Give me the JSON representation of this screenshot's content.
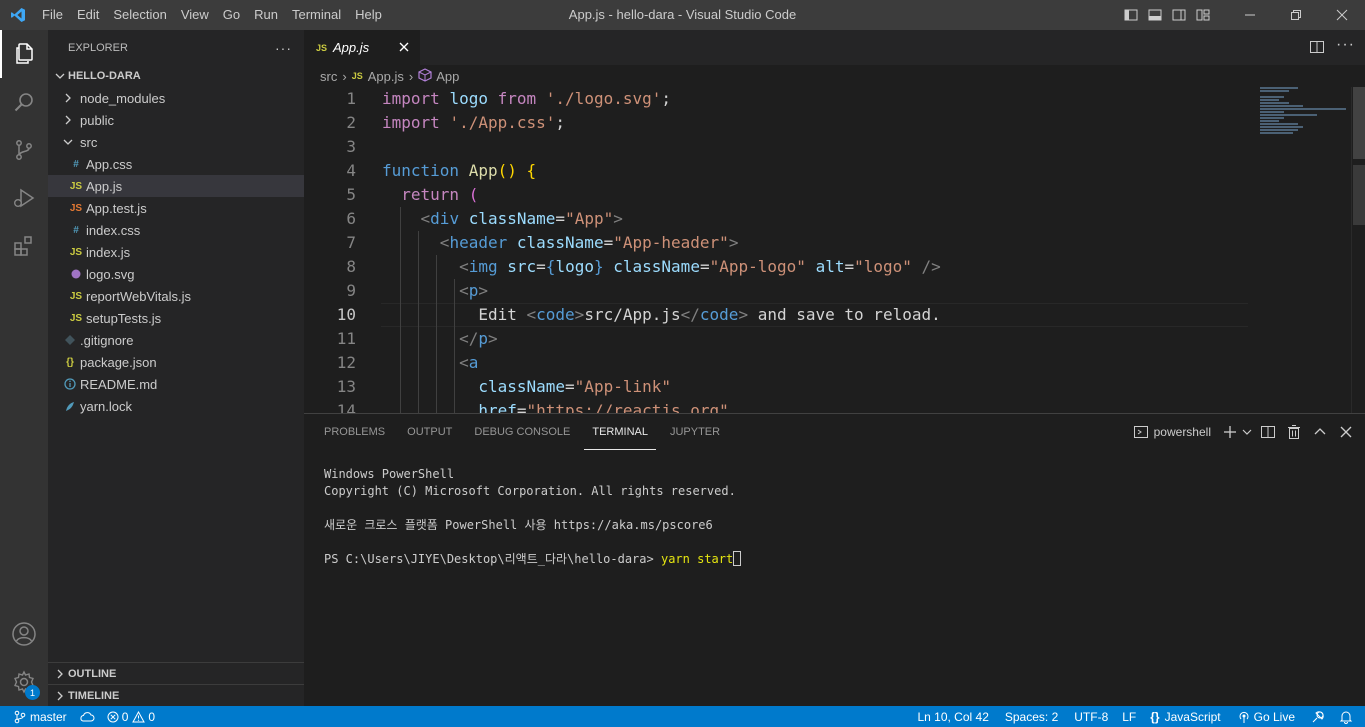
{
  "titlebar": {
    "menu": [
      "File",
      "Edit",
      "Selection",
      "View",
      "Go",
      "Run",
      "Terminal",
      "Help"
    ],
    "window_title": "App.js - hello-dara - Visual Studio Code"
  },
  "activitybar": {
    "items": [
      "files-icon",
      "search-icon",
      "source-control-icon",
      "run-debug-icon",
      "extensions-icon"
    ],
    "bottom": [
      "account-icon",
      "manage-gear-icon"
    ],
    "manage_badge": "1"
  },
  "explorer": {
    "header": "EXPLORER",
    "more": "···",
    "root": "HELLO-DARA",
    "items": [
      {
        "name": "node_modules",
        "kind": "folder",
        "depth": 0
      },
      {
        "name": "public",
        "kind": "folder",
        "depth": 0
      },
      {
        "name": "src",
        "kind": "folder-open",
        "depth": 0
      },
      {
        "name": "App.css",
        "kind": "css",
        "depth": 1
      },
      {
        "name": "App.js",
        "kind": "js",
        "depth": 1
      },
      {
        "name": "App.test.js",
        "kind": "test",
        "depth": 1
      },
      {
        "name": "index.css",
        "kind": "css",
        "depth": 1
      },
      {
        "name": "index.js",
        "kind": "js",
        "depth": 1
      },
      {
        "name": "logo.svg",
        "kind": "svg",
        "depth": 1
      },
      {
        "name": "reportWebVitals.js",
        "kind": "js",
        "depth": 1
      },
      {
        "name": "setupTests.js",
        "kind": "js",
        "depth": 1
      },
      {
        "name": ".gitignore",
        "kind": "git",
        "depth": 0
      },
      {
        "name": "package.json",
        "kind": "json",
        "depth": 0
      },
      {
        "name": "README.md",
        "kind": "info",
        "depth": 0
      },
      {
        "name": "yarn.lock",
        "kind": "yarn",
        "depth": 0
      }
    ],
    "selected": "App.js",
    "outline": "OUTLINE",
    "timeline": "TIMELINE"
  },
  "editor": {
    "tab_label": "App.js",
    "tab_badge": "JS",
    "breadcrumb": [
      "src",
      "App.js",
      "App"
    ],
    "current_line": 10,
    "lines": [
      {
        "n": "1",
        "html": "<span class='k'>import</span> <span class='v'>logo</span> <span class='k'>from</span> <span class='s'>'./logo.svg'</span><span class='tx'>;</span>"
      },
      {
        "n": "2",
        "html": "<span class='k'>import</span> <span class='s'>'./App.css'</span><span class='tx'>;</span>"
      },
      {
        "n": "3",
        "html": ""
      },
      {
        "n": "4",
        "html": "<span class='kw'>function</span> <span class='f'>App</span><span class='b'>()</span> <span class='b'>{</span>"
      },
      {
        "n": "5",
        "html": "  <span class='k'>return</span> <span class='b2'>(</span>"
      },
      {
        "n": "6",
        "html": "    <span class='p'>&lt;</span><span class='t'>div</span> <span class='v'>className</span><span class='tx'>=</span><span class='s'>\"App\"</span><span class='p'>&gt;</span>"
      },
      {
        "n": "7",
        "html": "      <span class='p'>&lt;</span><span class='t'>header</span> <span class='v'>className</span><span class='tx'>=</span><span class='s'>\"App-header\"</span><span class='p'>&gt;</span>"
      },
      {
        "n": "8",
        "html": "        <span class='p'>&lt;</span><span class='t'>img</span> <span class='v'>src</span><span class='tx'>=</span><span class='kw'>{</span><span class='v'>logo</span><span class='kw'>}</span> <span class='v'>className</span><span class='tx'>=</span><span class='s'>\"App-logo\"</span> <span class='v'>alt</span><span class='tx'>=</span><span class='s'>\"logo\"</span> <span class='p'>/&gt;</span>"
      },
      {
        "n": "9",
        "html": "        <span class='p'>&lt;</span><span class='t'>p</span><span class='p'>&gt;</span>"
      },
      {
        "n": "10",
        "html": "          <span class='tx'>Edit </span><span class='p'>&lt;</span><span class='t'>code</span><span class='p'>&gt;</span><span class='tx'>src/App.js</span><span class='p'>&lt;/</span><span class='t'>code</span><span class='p'>&gt;</span><span class='tx'> and save to reload.</span>"
      },
      {
        "n": "11",
        "html": "        <span class='p'>&lt;/</span><span class='t'>p</span><span class='p'>&gt;</span>"
      },
      {
        "n": "12",
        "html": "        <span class='p'>&lt;</span><span class='t'>a</span>"
      },
      {
        "n": "13",
        "html": "          <span class='v'>className</span><span class='tx'>=</span><span class='s'>\"App-link\"</span>"
      },
      {
        "n": "14",
        "html": "          <span class='v'>href</span><span class='tx'>=</span><span class='s'>\"https://reactjs.org\"</span>"
      }
    ]
  },
  "panel": {
    "tabs": [
      "PROBLEMS",
      "OUTPUT",
      "DEBUG CONSOLE",
      "TERMINAL",
      "JUPYTER"
    ],
    "active_tab": "TERMINAL",
    "shell": "powershell",
    "terminal_lines": [
      "Windows PowerShell",
      "Copyright (C) Microsoft Corporation. All rights reserved.",
      "",
      "새로운 크로스 플랫폼 PowerShell 사용 https://aka.ms/pscore6",
      ""
    ],
    "prompt": "PS C:\\Users\\JIYE\\Desktop\\리액트_다라\\hello-dara> ",
    "command": "yarn start"
  },
  "statusbar": {
    "branch": "master",
    "errors": "0",
    "warnings": "0",
    "position": "Ln 10, Col 42",
    "spaces": "Spaces: 2",
    "encoding": "UTF-8",
    "eol": "LF",
    "language": "JavaScript",
    "golive": "Go Live"
  },
  "colors": {
    "accent": "#007acc",
    "titlebar": "#3c3c3c",
    "activitybar": "#333333",
    "sidebar": "#252526",
    "editor": "#1e1e1e"
  }
}
